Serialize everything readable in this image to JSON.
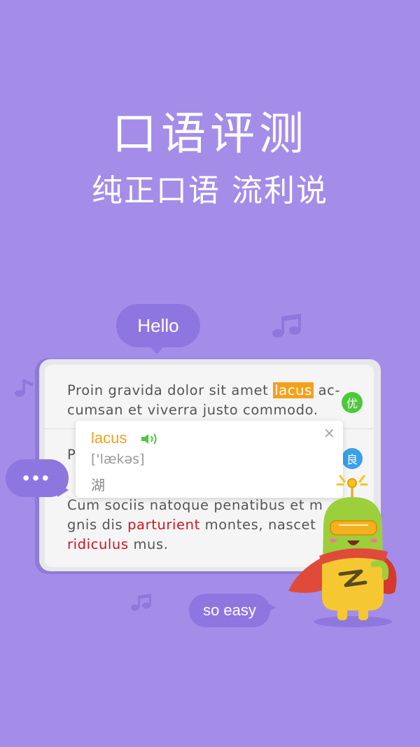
{
  "header": {
    "title": "口语评测",
    "subtitle": "纯正口语 流利说"
  },
  "bubbles": {
    "hello": "Hello",
    "dots": "•••",
    "easy": "so easy"
  },
  "card": {
    "para1": {
      "before": "Proin gravida dolor sit amet ",
      "highlight": "lacus",
      "after": " ac-",
      "line2": "cumsan et viverra justo commodo."
    },
    "para2_start": "P",
    "para3": {
      "line1": "Cum sociis natoque penatibus et m",
      "line2_a": "gnis dis ",
      "line2_red": "parturient",
      "line2_b": " montes, nascet",
      "line3_red": "ridiculus",
      "line3_b": " mus."
    },
    "badges": {
      "excellent": "优",
      "good": "良"
    }
  },
  "popup": {
    "word": "lacus",
    "phonetic": "['lækəs]",
    "meaning": "湖",
    "close": "✕"
  },
  "colors": {
    "background": "#a48de9",
    "bubble": "#8e76e0",
    "highlight": "#f3a11c",
    "badge_excellent": "#4cc838",
    "badge_good": "#3aa0e8",
    "error_word": "#d0141d"
  },
  "icons": [
    "music-note-icon",
    "speaker-icon",
    "close-icon",
    "mascot-illustration"
  ]
}
